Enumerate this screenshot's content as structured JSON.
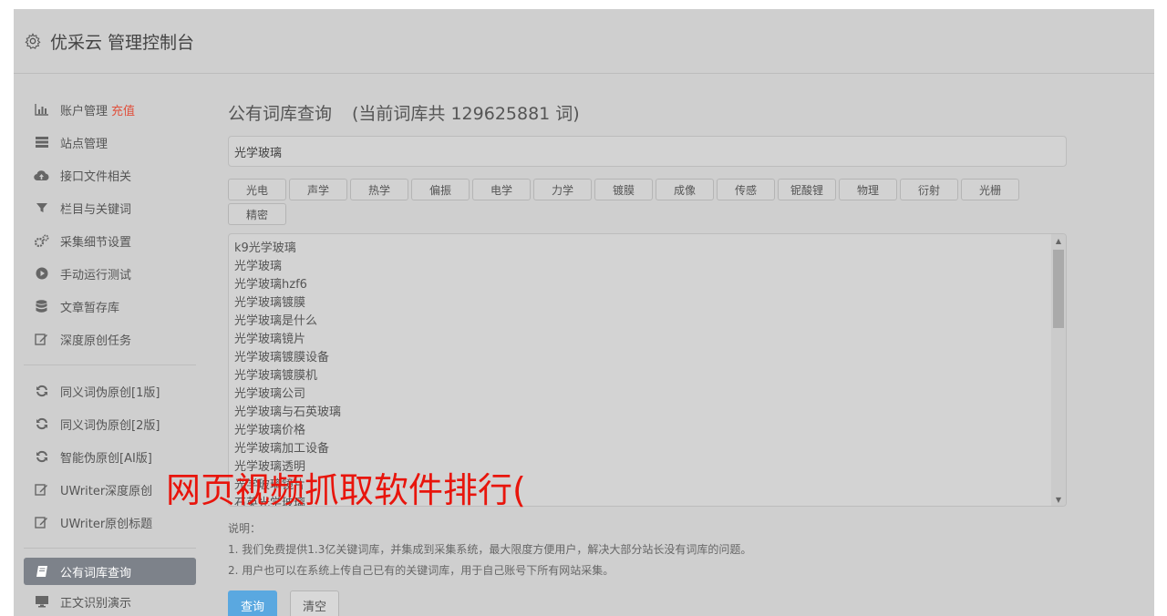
{
  "header": {
    "title": "优采云 管理控制台"
  },
  "sidebar": {
    "group1": [
      {
        "label": "账户管理",
        "badge": "充值",
        "icon": "bar-chart-icon"
      },
      {
        "label": "站点管理",
        "icon": "server-icon"
      },
      {
        "label": "接口文件相关",
        "icon": "cloud-upload-icon"
      },
      {
        "label": "栏目与关键词",
        "icon": "filter-icon"
      },
      {
        "label": "采集细节设置",
        "icon": "cogs-icon"
      },
      {
        "label": "手动运行测试",
        "icon": "play-icon"
      },
      {
        "label": "文章暂存库",
        "icon": "database-icon"
      },
      {
        "label": "深度原创任务",
        "icon": "edit-icon"
      }
    ],
    "group2": [
      {
        "label": "同义词伪原创[1版]",
        "icon": "refresh-icon"
      },
      {
        "label": "同义词伪原创[2版]",
        "icon": "refresh-icon"
      },
      {
        "label": "智能伪原创[AI版]",
        "icon": "refresh-icon"
      },
      {
        "label": "UWriter深度原创",
        "icon": "edit-icon"
      },
      {
        "label": "UWriter原创标题",
        "icon": "edit-icon"
      }
    ],
    "group3": [
      {
        "label": "公有词库查询",
        "icon": "book-icon",
        "active": true
      },
      {
        "label": "正文识别演示",
        "icon": "monitor-icon"
      }
    ]
  },
  "main": {
    "title": "公有词库查询",
    "count_text": "(当前词库共 129625881 词)",
    "search_value": "光学玻璃",
    "tags": [
      "光电",
      "声学",
      "热学",
      "偏振",
      "电学",
      "力学",
      "镀膜",
      "成像",
      "传感",
      "铌酸锂",
      "物理",
      "衍射",
      "光栅",
      "精密"
    ],
    "results": [
      "k9光学玻璃",
      "光学玻璃",
      "光学玻璃hzf6",
      "光学玻璃镀膜",
      "光学玻璃是什么",
      "光学玻璃镜片",
      "光学玻璃镀膜设备",
      "光学玻璃镀膜机",
      "光学玻璃公司",
      "光学玻璃与石英玻璃",
      "光学玻璃价格",
      "光学玻璃加工设备",
      "光学玻璃透明",
      "光学玻璃镜片",
      "石英光学玻璃"
    ],
    "notes_title": "说明：",
    "notes": [
      "1. 我们免费提供1.3亿关键词库，并集成到采集系统，最大限度方便用户，解决大部分站长没有词库的问题。",
      "2. 用户也可以在系统上传自己已有的关键词库，用于自己账号下所有网站采集。"
    ],
    "query_button": "查询",
    "clear_button": "清空"
  },
  "overlay_text": "网页视频抓取软件排行(",
  "colors": {
    "accent": "#5aa8e0",
    "recharge": "#e0503c",
    "overlay": "#e8150c",
    "active_item": "#7d828a"
  }
}
